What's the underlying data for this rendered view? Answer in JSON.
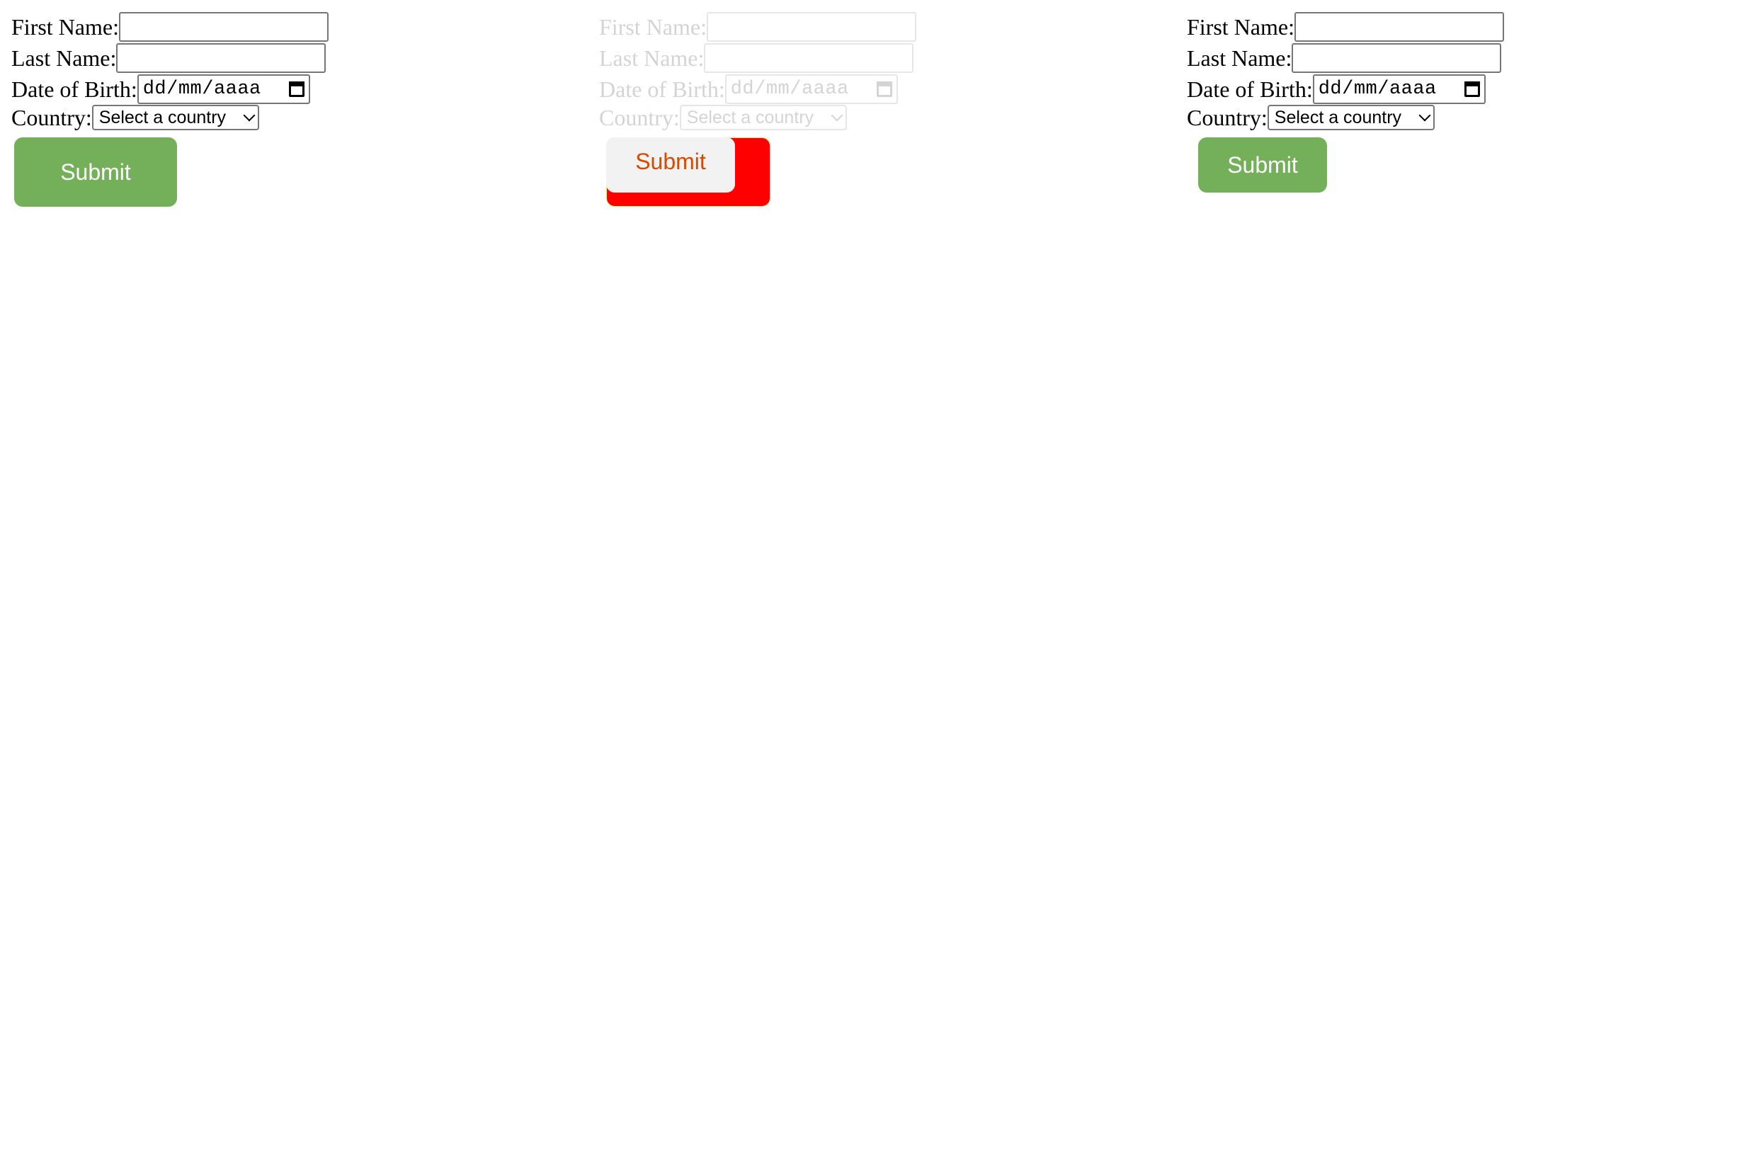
{
  "forms": [
    {
      "first_name_label": "First Name:",
      "last_name_label": "Last Name:",
      "dob_label": "Date of Birth:",
      "dob_placeholder": "dd/mm/aaaa",
      "country_label": "Country:",
      "country_selected": "Select a country",
      "submit_label": "Submit"
    },
    {
      "first_name_label": "First Name:",
      "last_name_label": "Last Name:",
      "dob_label": "Date of Birth:",
      "dob_placeholder": "dd/mm/aaaa",
      "country_label": "Country:",
      "country_selected": "Select a country",
      "submit_label_back": "Submit",
      "submit_label_front": "Submit"
    },
    {
      "first_name_label": "First Name:",
      "last_name_label": "Last Name:",
      "dob_label": "Date of Birth:",
      "dob_placeholder": "dd/mm/aaaa",
      "country_label": "Country:",
      "country_selected": "Select a country",
      "submit_label": "Submit"
    }
  ],
  "colors": {
    "submit_green": "#74b05a",
    "submit_red": "#ff0000",
    "submit_text_orange": "#d64a00",
    "faded_text": "#d4d4d4"
  }
}
